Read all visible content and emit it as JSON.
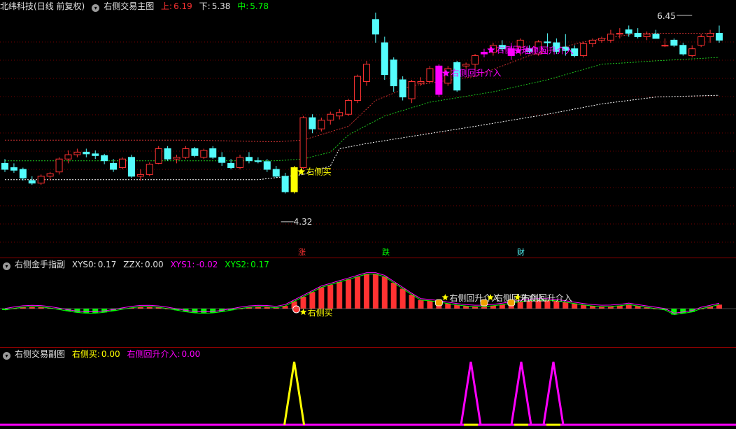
{
  "main": {
    "stock_name": "北纬科技",
    "period": "(日线 前复权)",
    "formula": "右侧交易主图",
    "up_label": "上:",
    "up_value": "6.19",
    "down_label": "下:",
    "down_value": "5.38",
    "mid_label": "中:",
    "mid_value": "5.78",
    "high_mark": "6.45",
    "low_mark": "4.32",
    "buy_label": "右侧买",
    "readd_label": "右侧回升介入",
    "tags": [
      "涨",
      "跌",
      "财"
    ]
  },
  "sub1": {
    "title": "右侧金手指副",
    "xys0_label": "XYS0:",
    "xys0_value": "0.17",
    "zzx_label": "ZZX:",
    "zzx_value": "0.00",
    "xys1_label": "XYS1:",
    "xys1_value": "-0.02",
    "xys2_label": "XYS2:",
    "xys2_value": "0.17",
    "buy_label": "右侧买",
    "readd_label": "右侧回升介入"
  },
  "sub2": {
    "title": "右侧交易副图",
    "buy_label": "右侧买:",
    "buy_value": "0.00",
    "readd_label": "右侧回升介入:",
    "readd_value": "0.00"
  },
  "colors": {
    "up": "#ff3232",
    "down": "#54fcfc",
    "yellow": "#ffff00",
    "magenta": "#ff00ff",
    "green": "#00ff00",
    "white": "#ffffff",
    "grid": "#8b0000"
  },
  "chart_data": {
    "type": "candlestick",
    "ohlc": [
      [
        5.05,
        5.1,
        4.95,
        4.98
      ],
      [
        5.0,
        5.05,
        4.94,
        4.97
      ],
      [
        4.98,
        5.0,
        4.85,
        4.88
      ],
      [
        4.85,
        4.9,
        4.8,
        4.82
      ],
      [
        4.82,
        4.92,
        4.8,
        4.9
      ],
      [
        4.9,
        4.95,
        4.85,
        4.93
      ],
      [
        4.95,
        5.12,
        4.92,
        5.1
      ],
      [
        5.1,
        5.2,
        5.05,
        5.15
      ],
      [
        5.15,
        5.22,
        5.12,
        5.18
      ],
      [
        5.18,
        5.22,
        5.12,
        5.16
      ],
      [
        5.16,
        5.2,
        5.1,
        5.14
      ],
      [
        5.14,
        5.16,
        5.04,
        5.08
      ],
      [
        5.05,
        5.1,
        4.95,
        4.98
      ],
      [
        5.0,
        5.12,
        4.98,
        5.1
      ],
      [
        5.12,
        5.15,
        4.88,
        4.9
      ],
      [
        4.9,
        4.98,
        4.85,
        4.92
      ],
      [
        4.92,
        5.06,
        4.9,
        5.04
      ],
      [
        5.05,
        5.25,
        5.04,
        5.22
      ],
      [
        5.22,
        5.25,
        5.08,
        5.1
      ],
      [
        5.1,
        5.15,
        5.05,
        5.12
      ],
      [
        5.12,
        5.25,
        5.1,
        5.22
      ],
      [
        5.22,
        5.24,
        5.12,
        5.14
      ],
      [
        5.12,
        5.22,
        5.1,
        5.2
      ],
      [
        5.22,
        5.25,
        5.1,
        5.12
      ],
      [
        5.12,
        5.18,
        5.02,
        5.06
      ],
      [
        5.05,
        5.1,
        4.98,
        5.0
      ],
      [
        5.0,
        5.15,
        4.98,
        5.12
      ],
      [
        5.12,
        5.18,
        5.05,
        5.08
      ],
      [
        5.08,
        5.12,
        5.05,
        5.07
      ],
      [
        5.07,
        5.1,
        4.95,
        4.98
      ],
      [
        4.98,
        5.02,
        4.88,
        4.9
      ],
      [
        4.9,
        4.94,
        4.7,
        4.72
      ],
      [
        4.72,
        5.02,
        4.7,
        5.0
      ],
      [
        5.0,
        5.6,
        4.98,
        5.58
      ],
      [
        5.58,
        5.62,
        5.4,
        5.45
      ],
      [
        5.45,
        5.58,
        5.42,
        5.55
      ],
      [
        5.55,
        5.65,
        5.5,
        5.62
      ],
      [
        5.6,
        5.68,
        5.56,
        5.64
      ],
      [
        5.62,
        5.8,
        5.6,
        5.78
      ],
      [
        5.78,
        6.08,
        5.75,
        6.06
      ],
      [
        6.0,
        6.24,
        5.95,
        6.2
      ],
      [
        6.72,
        6.8,
        6.45,
        6.55
      ],
      [
        6.45,
        6.52,
        6.02,
        6.08
      ],
      [
        6.25,
        6.28,
        5.88,
        5.95
      ],
      [
        6.02,
        6.06,
        5.78,
        5.82
      ],
      [
        5.8,
        6.02,
        5.75,
        6.0
      ],
      [
        5.98,
        6.05,
        5.95,
        6.0
      ],
      [
        6.0,
        6.18,
        5.98,
        6.15
      ],
      [
        5.85,
        6.2,
        5.82,
        6.18
      ],
      [
        5.98,
        6.18,
        5.95,
        6.15
      ],
      [
        6.22,
        6.24,
        5.88,
        5.9
      ],
      [
        6.18,
        6.22,
        6.15,
        6.2
      ],
      [
        6.2,
        6.32,
        6.12,
        6.3
      ],
      [
        6.32,
        6.38,
        6.28,
        6.34
      ],
      [
        6.34,
        6.45,
        6.3,
        6.42
      ],
      [
        6.42,
        6.48,
        6.35,
        6.38
      ],
      [
        6.3,
        6.45,
        6.25,
        6.38
      ],
      [
        6.4,
        6.5,
        6.3,
        6.48
      ],
      [
        6.38,
        6.42,
        6.32,
        6.35
      ],
      [
        6.32,
        6.48,
        6.3,
        6.46
      ],
      [
        6.46,
        6.56,
        6.4,
        6.45
      ],
      [
        6.45,
        6.5,
        6.32,
        6.35
      ],
      [
        6.4,
        6.55,
        6.3,
        6.36
      ],
      [
        6.38,
        6.42,
        6.28,
        6.3
      ],
      [
        6.3,
        6.46,
        6.28,
        6.44
      ],
      [
        6.44,
        6.5,
        6.4,
        6.48
      ],
      [
        6.48,
        6.52,
        6.45,
        6.5
      ],
      [
        6.48,
        6.6,
        6.45,
        6.55
      ],
      [
        6.55,
        6.62,
        6.5,
        6.56
      ],
      [
        6.6,
        6.65,
        6.52,
        6.56
      ],
      [
        6.56,
        6.62,
        6.5,
        6.52
      ],
      [
        6.52,
        6.58,
        6.48,
        6.55
      ],
      [
        6.55,
        6.6,
        6.5,
        6.5
      ],
      [
        6.42,
        6.5,
        6.4,
        6.42
      ],
      [
        6.48,
        6.5,
        6.4,
        6.42
      ],
      [
        6.42,
        6.45,
        6.3,
        6.32
      ],
      [
        6.3,
        6.42,
        6.28,
        6.38
      ],
      [
        6.42,
        6.55,
        6.4,
        6.52
      ],
      [
        6.52,
        6.6,
        6.45,
        6.56
      ],
      [
        6.56,
        6.65,
        6.45,
        6.48
      ]
    ]
  }
}
